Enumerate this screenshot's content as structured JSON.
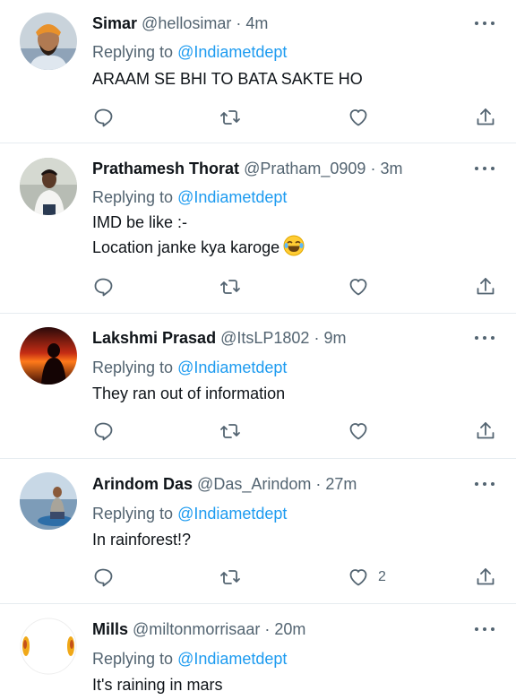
{
  "tweets": [
    {
      "name": "Simar",
      "handle": "@hellosimar",
      "sep": "·",
      "time": "4m",
      "replying_prefix": "Replying to",
      "mention": "@Indiametdept",
      "lines": [
        "ARAAM SE BHI TO BATA SAKTE HO"
      ],
      "like_count": ""
    },
    {
      "name": "Prathamesh Thorat",
      "handle": "@Pratham_0909",
      "sep": "·",
      "time": "3m",
      "replying_prefix": "Replying to",
      "mention": "@Indiametdept",
      "lines": [
        "IMD be like :-",
        "Location janke kya karoge"
      ],
      "emoji": "😂",
      "like_count": ""
    },
    {
      "name": "Lakshmi Prasad",
      "handle": "@ItsLP1802",
      "sep": "·",
      "time": "9m",
      "replying_prefix": "Replying to",
      "mention": "@Indiametdept",
      "lines": [
        "They ran out of information"
      ],
      "like_count": ""
    },
    {
      "name": "Arindom Das",
      "handle": "@Das_Arindom",
      "sep": "·",
      "time": "27m",
      "replying_prefix": "Replying to",
      "mention": "@Indiametdept",
      "lines": [
        "In rainforest!?"
      ],
      "like_count": "2"
    },
    {
      "name": "Mills",
      "handle": "@miltonmorrisaar",
      "sep": "·",
      "time": "20m",
      "replying_prefix": "Replying to",
      "mention": "@Indiametdept",
      "lines": [
        "It's raining in mars"
      ],
      "like_count": ""
    }
  ],
  "colors": {
    "accent": "#1d9bf0",
    "secondary_text": "#536471",
    "primary_text": "#0f1419",
    "divider": "#e6ecf0"
  },
  "icons": {
    "reply": "reply-icon",
    "retweet": "retweet-icon",
    "like": "heart-icon",
    "share": "share-icon",
    "more": "more-icon"
  }
}
